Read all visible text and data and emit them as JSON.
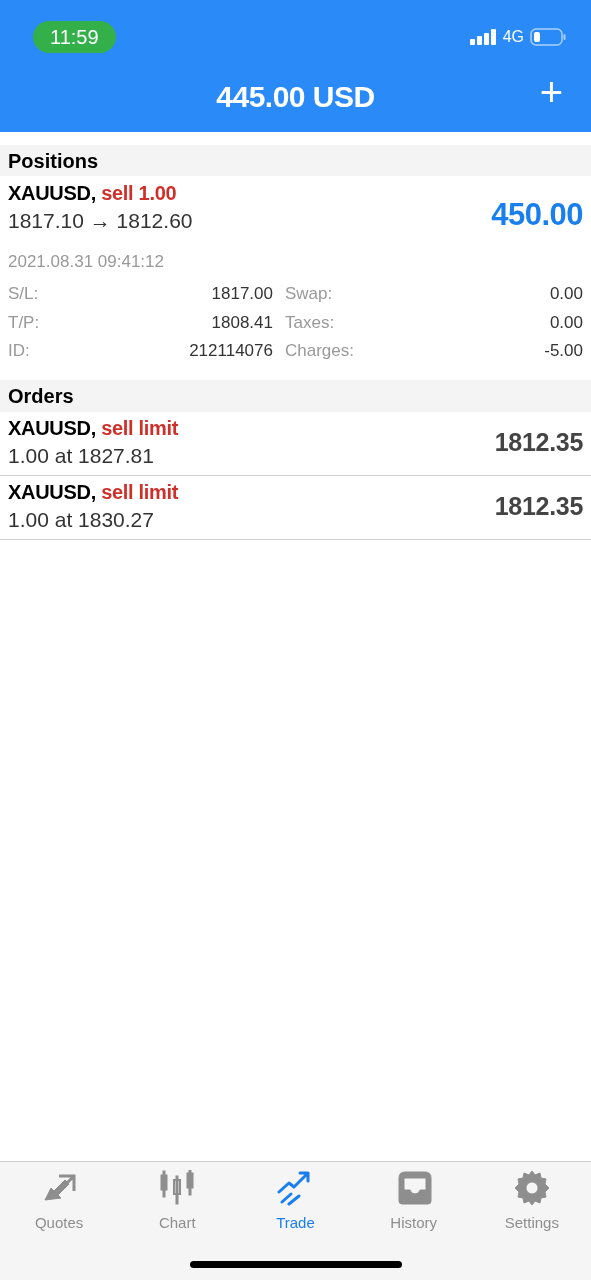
{
  "status_bar": {
    "time": "11:59",
    "network": "4G"
  },
  "header": {
    "title": "445.00 USD",
    "add_button": "+"
  },
  "positions": {
    "title": "Positions",
    "items": [
      {
        "symbol": "XAUUSD,",
        "action": "sell 1.00",
        "prices": "1817.10 → 1812.60",
        "profit": "450.00",
        "time": "2021.08.31 09:41:12",
        "details": [
          {
            "label": "S/L:",
            "value": "1817.00",
            "label2": "Swap:",
            "value2": "0.00"
          },
          {
            "label": "T/P:",
            "value": "1808.41",
            "label2": "Taxes:",
            "value2": "0.00"
          },
          {
            "label": "ID:",
            "value": "212114076",
            "label2": "Charges:",
            "value2": "-5.00"
          }
        ]
      }
    ]
  },
  "orders": {
    "title": "Orders",
    "items": [
      {
        "symbol": "XAUUSD,",
        "action": "sell limit",
        "detail": "1.00 at 1827.81",
        "price": "1812.35"
      },
      {
        "symbol": "XAUUSD,",
        "action": "sell limit",
        "detail": "1.00 at 1830.27",
        "price": "1812.35"
      }
    ]
  },
  "tab_bar": [
    {
      "label": "Quotes",
      "selected": false
    },
    {
      "label": "Chart",
      "selected": false
    },
    {
      "label": "Trade",
      "selected": true
    },
    {
      "label": "History",
      "selected": false
    },
    {
      "label": "Settings",
      "selected": false
    }
  ]
}
